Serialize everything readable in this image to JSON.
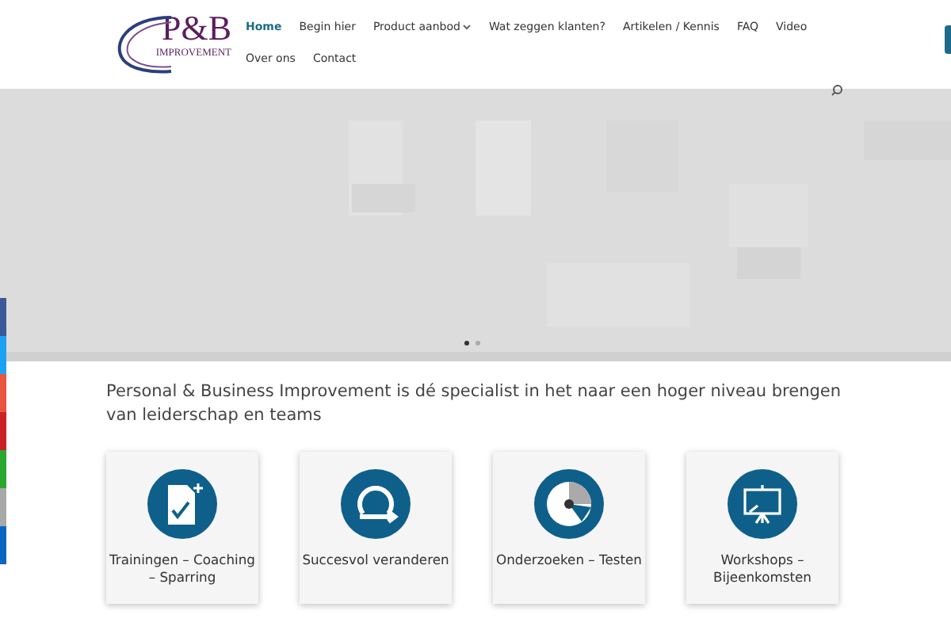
{
  "logo": {
    "initials": "P&B",
    "subtitle": "IMPROVEMENT"
  },
  "nav": [
    {
      "label": "Home",
      "selected": true,
      "dropdown": false
    },
    {
      "label": "Begin hier",
      "selected": false,
      "dropdown": false
    },
    {
      "label": "Product aanbod",
      "selected": false,
      "dropdown": true
    },
    {
      "label": "Wat zeggen klanten?",
      "selected": false,
      "dropdown": false
    },
    {
      "label": "Artikelen / Kennis",
      "selected": false,
      "dropdown": false
    },
    {
      "label": "FAQ",
      "selected": false,
      "dropdown": false
    },
    {
      "label": "Video",
      "selected": false,
      "dropdown": false
    },
    {
      "label": "Over ons",
      "selected": false,
      "dropdown": false
    },
    {
      "label": "Contact",
      "selected": false,
      "dropdown": false
    }
  ],
  "hero": {
    "kind": "picture",
    "slides": [
      {
        "selected": true
      },
      {
        "selected": false
      }
    ]
  },
  "share_bar": [
    {
      "color": "#3b5998"
    },
    {
      "color": "#1da1f2"
    },
    {
      "color": "#e8543f"
    },
    {
      "color": "#cb2027"
    },
    {
      "color": "#2ba82e"
    },
    {
      "color": "#a8a8a8"
    },
    {
      "color": "#0a66c2"
    }
  ],
  "intro": "Personal & Business Improvement is dé specialist in het naar een hoger niveau brengen van leiderschap en teams",
  "cards": [
    {
      "kind": "document",
      "label": "Trainingen – Coaching – Sparring"
    },
    {
      "kind": "cycle",
      "label": "Succesvol veranderen"
    },
    {
      "kind": "pie",
      "label": "Onderzoeken – Testen"
    },
    {
      "kind": "board",
      "label": "Workshops – Bijeenkomsten"
    }
  ]
}
